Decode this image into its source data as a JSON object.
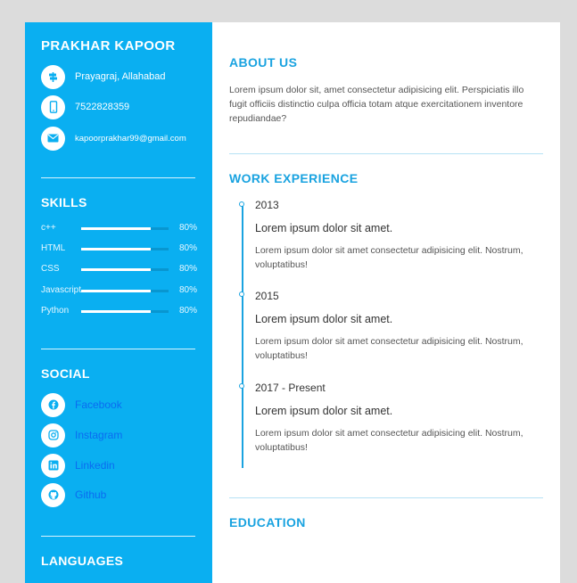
{
  "profile": {
    "name": "PRAKHAR KAPOOR",
    "location": "Prayagraj, Allahabad",
    "phone": "7522828359",
    "email": "kapoorprakhar99@gmail.com"
  },
  "skills": {
    "title": "SKILLS",
    "items": [
      {
        "name": "c++",
        "level": 0.8,
        "percent": "80%"
      },
      {
        "name": "HTML",
        "level": 0.8,
        "percent": "80%"
      },
      {
        "name": "CSS",
        "level": 0.8,
        "percent": "80%"
      },
      {
        "name": "Javascript",
        "level": 0.8,
        "percent": "80%"
      },
      {
        "name": "Python",
        "level": 0.8,
        "percent": "80%"
      }
    ]
  },
  "social": {
    "title": "SOCIAL",
    "items": [
      {
        "label": "Facebook",
        "icon": "facebook-icon"
      },
      {
        "label": "Instagram",
        "icon": "instagram-icon"
      },
      {
        "label": "Linkedin",
        "icon": "linkedin-icon"
      },
      {
        "label": "Github",
        "icon": "github-icon"
      }
    ]
  },
  "languages": {
    "title": "LANGUAGES"
  },
  "about": {
    "title": "ABOUT US",
    "text": "Lorem ipsum dolor sit, amet consectetur adipisicing elit. Perspiciatis illo fugit officiis distinctio culpa officia totam atque exercitationem inventore repudiandae?"
  },
  "work": {
    "title": "WORK EXPERIENCE",
    "items": [
      {
        "year": "2013",
        "title": "Lorem ipsum dolor sit amet.",
        "desc": "Lorem ipsum dolor sit amet consectetur adipisicing elit. Nostrum, voluptatibus!"
      },
      {
        "year": "2015",
        "title": "Lorem ipsum dolor sit amet.",
        "desc": "Lorem ipsum dolor sit amet consectetur adipisicing elit. Nostrum, voluptatibus!"
      },
      {
        "year": "2017 - Present",
        "title": "Lorem ipsum dolor sit amet.",
        "desc": "Lorem ipsum dolor sit amet consectetur adipisicing elit. Nostrum, voluptatibus!"
      }
    ]
  },
  "education": {
    "title": "EDUCATION"
  },
  "colors": {
    "sidebar": "#0aaff1",
    "accent": "#1aa3e0",
    "link": "#0a6cf1"
  }
}
